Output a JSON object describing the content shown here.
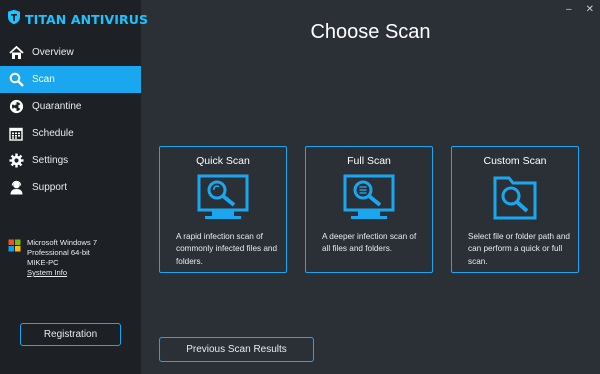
{
  "app": {
    "logo_text": "TITAN ANTIVIRUS",
    "accent_color": "#1ba7f0"
  },
  "window_controls": {
    "minimize": "–",
    "close": "✕"
  },
  "sidebar": {
    "items": [
      {
        "label": "Overview",
        "icon": "home-icon"
      },
      {
        "label": "Scan",
        "icon": "search-icon",
        "active": true
      },
      {
        "label": "Quarantine",
        "icon": "biohazard-icon"
      },
      {
        "label": "Schedule",
        "icon": "calendar-icon"
      },
      {
        "label": "Settings",
        "icon": "gear-icon"
      },
      {
        "label": "Support",
        "icon": "support-agent-icon"
      }
    ],
    "system_info": {
      "os_line1": "Microsoft Windows 7",
      "os_line2": "Professional  64-bit",
      "machine": "MIKE-PC",
      "link": "System Info"
    },
    "registration_label": "Registration"
  },
  "main": {
    "title": "Choose Scan",
    "cards": [
      {
        "title": "Quick Scan",
        "icon": "monitor-quick-scan-icon",
        "description": "A rapid infection scan of commonly infected files and folders."
      },
      {
        "title": "Full Scan",
        "icon": "monitor-full-scan-icon",
        "description": "A deeper infection scan of all files and folders."
      },
      {
        "title": "Custom Scan",
        "icon": "folder-search-icon",
        "description": "Select file or folder path and can perform a quick or full scan."
      }
    ],
    "previous_results_label": "Previous Scan Results"
  }
}
